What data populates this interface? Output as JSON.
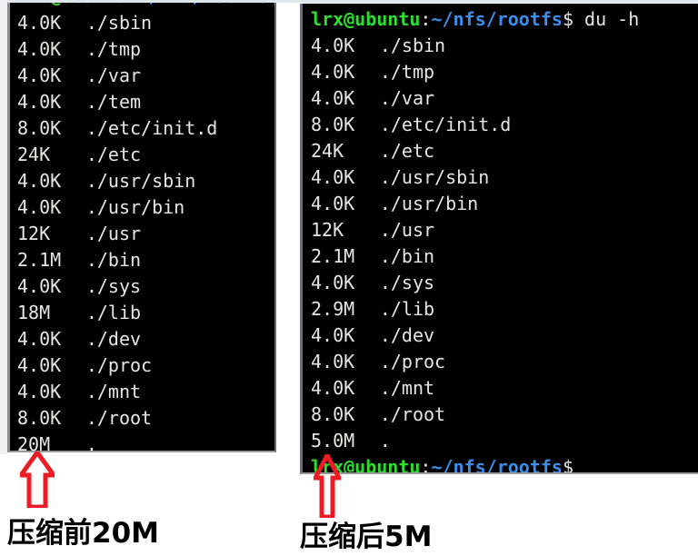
{
  "left_terminal": {
    "name": "terminal-before-compression",
    "top_cut_prompt": true,
    "rows": [
      {
        "size": "4.0K",
        "path": "./sbin"
      },
      {
        "size": "4.0K",
        "path": "./tmp"
      },
      {
        "size": "4.0K",
        "path": "./var"
      },
      {
        "size": "4.0K",
        "path": "./tem"
      },
      {
        "size": "8.0K",
        "path": "./etc/init.d"
      },
      {
        "size": "24K",
        "path": "./etc"
      },
      {
        "size": "4.0K",
        "path": "./usr/sbin"
      },
      {
        "size": "4.0K",
        "path": "./usr/bin"
      },
      {
        "size": "12K",
        "path": "./usr"
      },
      {
        "size": "2.1M",
        "path": "./bin"
      },
      {
        "size": "4.0K",
        "path": "./sys"
      },
      {
        "size": "18M",
        "path": "./lib"
      },
      {
        "size": "4.0K",
        "path": "./dev"
      },
      {
        "size": "4.0K",
        "path": "./proc"
      },
      {
        "size": "4.0K",
        "path": "./mnt"
      },
      {
        "size": "8.0K",
        "path": "./root"
      },
      {
        "size": "20M",
        "path": "."
      }
    ]
  },
  "right_terminal": {
    "name": "terminal-after-compression",
    "prompt": {
      "user_host": "lrx@ubuntu",
      "colon": ":",
      "path": "~/nfs/rootfs",
      "dollar": "$",
      "command": " du -h"
    },
    "rows": [
      {
        "size": "4.0K",
        "path": "./sbin"
      },
      {
        "size": "4.0K",
        "path": "./tmp"
      },
      {
        "size": "4.0K",
        "path": "./var"
      },
      {
        "size": "8.0K",
        "path": "./etc/init.d"
      },
      {
        "size": "24K",
        "path": "./etc"
      },
      {
        "size": "4.0K",
        "path": "./usr/sbin"
      },
      {
        "size": "4.0K",
        "path": "./usr/bin"
      },
      {
        "size": "12K",
        "path": "./usr"
      },
      {
        "size": "2.1M",
        "path": "./bin"
      },
      {
        "size": "4.0K",
        "path": "./sys"
      },
      {
        "size": "2.9M",
        "path": "./lib"
      },
      {
        "size": "4.0K",
        "path": "./dev"
      },
      {
        "size": "4.0K",
        "path": "./proc"
      },
      {
        "size": "4.0K",
        "path": "./mnt"
      },
      {
        "size": "8.0K",
        "path": "./root"
      },
      {
        "size": "5.0M",
        "path": "."
      }
    ],
    "final_prompt": {
      "user_host": "lrx@ubuntu",
      "colon": ":",
      "path": "~/nfs/rootfs",
      "dollar": "$"
    }
  },
  "annotations": {
    "left": {
      "caption": "压缩前20M",
      "arrow": "up-arrow-outline",
      "color": "#ec1c24"
    },
    "right": {
      "caption": "压缩后5M",
      "arrow": "up-arrow-outline",
      "color": "#ec1c24"
    }
  },
  "colors": {
    "terminal_background": "#000000",
    "terminal_foreground": "#e8e6e3",
    "prompt_user": "#2ee02e",
    "prompt_path": "#3b8eea",
    "annotation_red": "#ec1c24",
    "page_background": "#ffffff"
  }
}
